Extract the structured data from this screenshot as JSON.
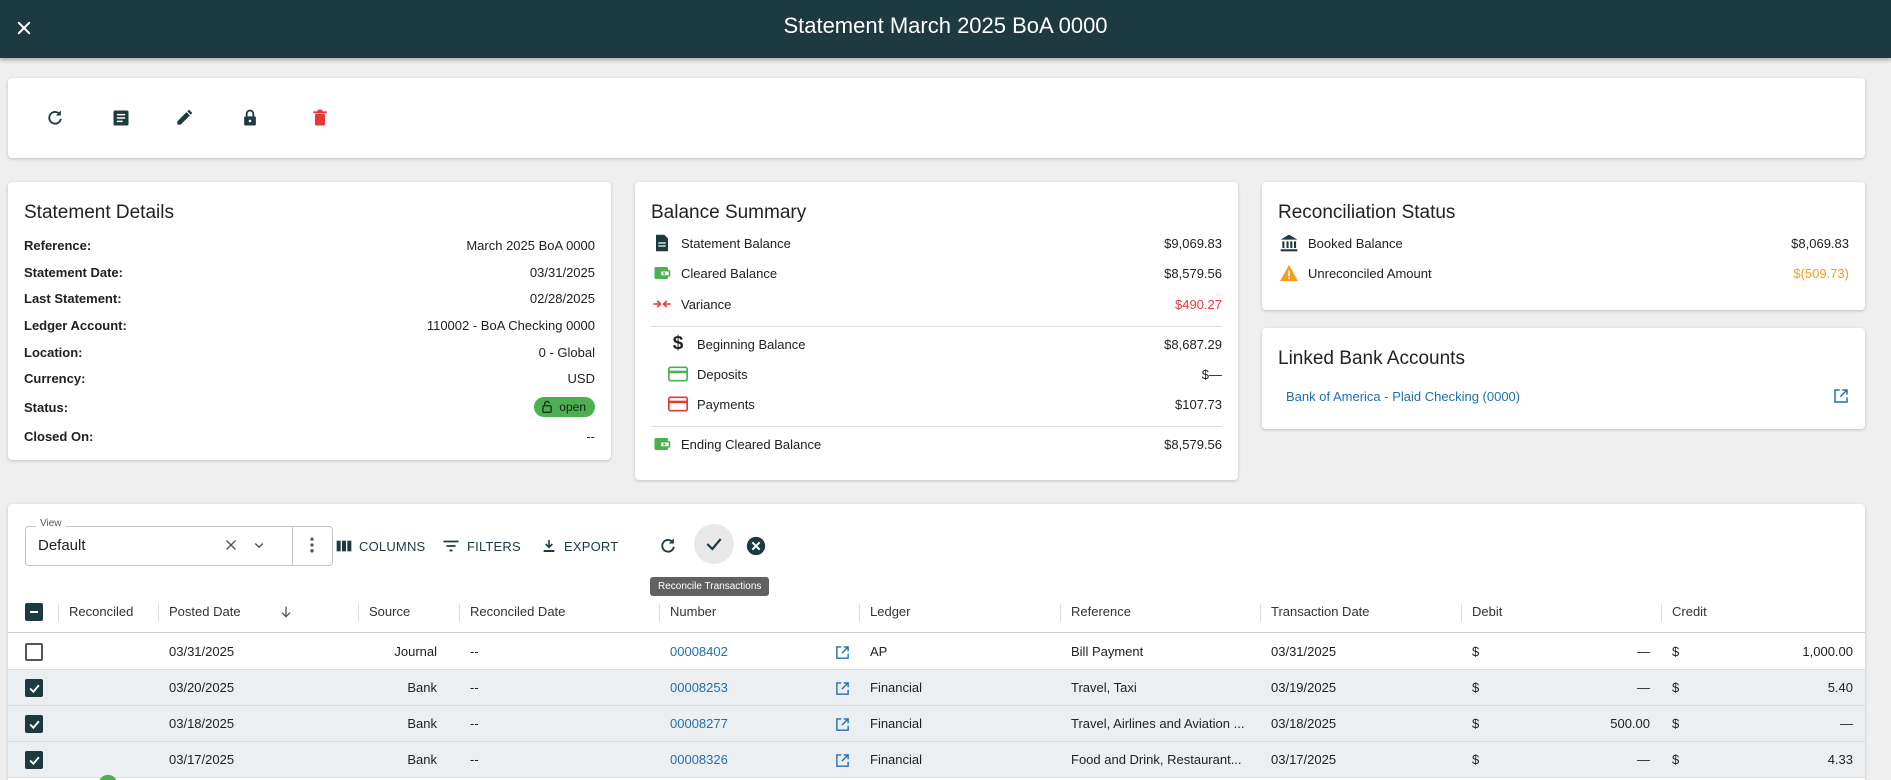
{
  "window": {
    "title": "Statement March 2025 BoA 0000"
  },
  "statement_details": {
    "title": "Statement Details",
    "rows": [
      {
        "label": "Reference:",
        "value": "March 2025 BoA 0000"
      },
      {
        "label": "Statement Date:",
        "value": "03/31/2025"
      },
      {
        "label": "Last Statement:",
        "value": "02/28/2025"
      },
      {
        "label": "Ledger Account:",
        "value": "110002 - BoA Checking 0000"
      },
      {
        "label": "Location:",
        "value": "0 - Global"
      },
      {
        "label": "Currency:",
        "value": "USD"
      },
      {
        "label": "Status:",
        "value": "open"
      },
      {
        "label": "Closed On:",
        "value": "--"
      }
    ]
  },
  "balance_summary": {
    "title": "Balance Summary",
    "statement_balance": {
      "label": "Statement Balance",
      "value": "$9,069.83"
    },
    "cleared_balance": {
      "label": "Cleared Balance",
      "value": "$8,579.56"
    },
    "variance": {
      "label": "Variance",
      "value": "$490.27"
    },
    "beginning_balance": {
      "label": "Beginning Balance",
      "value": "$8,687.29"
    },
    "deposits": {
      "label": "Deposits",
      "value": "$—"
    },
    "payments": {
      "label": "Payments",
      "value": "$107.73"
    },
    "ending_cleared_balance": {
      "label": "Ending Cleared Balance",
      "value": "$8,579.56"
    }
  },
  "reconciliation_status": {
    "title": "Reconciliation Status",
    "booked_balance": {
      "label": "Booked Balance",
      "value": "$8,069.83"
    },
    "unreconciled_amount": {
      "label": "Unreconciled Amount",
      "value": "$(509.73)"
    }
  },
  "linked_accounts": {
    "title": "Linked Bank Accounts",
    "items": [
      {
        "label": "Bank of America - Plaid Checking (0000)"
      }
    ]
  },
  "grid": {
    "view_label": "View",
    "view_value": "Default",
    "columns_label": "COLUMNS",
    "filters_label": "FILTERS",
    "export_label": "EXPORT",
    "tooltip": "Reconcile Transactions",
    "headers": {
      "reconciled": "Reconciled",
      "posted_date": "Posted Date",
      "source": "Source",
      "reconciled_date": "Reconciled Date",
      "number": "Number",
      "ledger": "Ledger",
      "reference": "Reference",
      "transaction_date": "Transaction Date",
      "debit": "Debit",
      "credit": "Credit"
    },
    "rows": [
      {
        "posted": "03/31/2025",
        "source": "Journal",
        "rec_date": "--",
        "number": "00008402",
        "ledger": "AP",
        "reference": "Bill Payment",
        "tx_date": "03/31/2025",
        "debit_cur": "$",
        "debit": "—",
        "credit_cur": "$",
        "credit": "1,000.00"
      },
      {
        "posted": "03/20/2025",
        "source": "Bank",
        "rec_date": "--",
        "number": "00008253",
        "ledger": "Financial",
        "reference": "Travel, Taxi",
        "tx_date": "03/19/2025",
        "debit_cur": "$",
        "debit": "—",
        "credit_cur": "$",
        "credit": "5.40"
      },
      {
        "posted": "03/18/2025",
        "source": "Bank",
        "rec_date": "--",
        "number": "00008277",
        "ledger": "Financial",
        "reference": "Travel, Airlines and Aviation ...",
        "tx_date": "03/18/2025",
        "debit_cur": "$",
        "debit": "500.00",
        "credit_cur": "$",
        "credit": "—"
      },
      {
        "posted": "03/17/2025",
        "source": "Bank",
        "rec_date": "--",
        "number": "00008326",
        "ledger": "Financial",
        "reference": "Food and Drink, Restaurant...",
        "tx_date": "03/17/2025",
        "debit_cur": "$",
        "debit": "—",
        "credit_cur": "$",
        "credit": "4.33"
      }
    ]
  },
  "colors": {
    "header_bg": "#1c3a40",
    "accent_green": "#4caf50",
    "negative_red": "#e53935",
    "warning_orange": "#f59c1a",
    "link_blue": "#1f6fb2"
  }
}
